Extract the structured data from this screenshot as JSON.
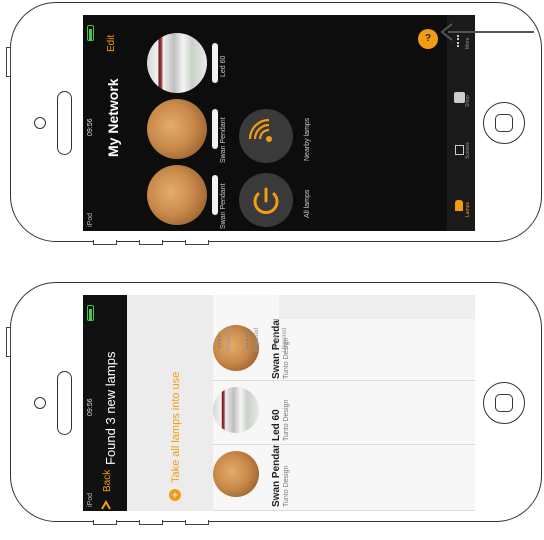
{
  "colors": {
    "accent": "#f39c12",
    "screen_dark": "#0d0d0d",
    "screen_light": "#eeeeef"
  },
  "top_screen": {
    "status": {
      "carrier": "iPod",
      "time": "09:56"
    },
    "title": "My Network",
    "edit_label": "Edit",
    "lamps": [
      {
        "name": "Swan Pendant",
        "thumb": "copper"
      },
      {
        "name": "Swan Pendant",
        "thumb": "copper"
      },
      {
        "name": "Led 60",
        "thumb": "led"
      }
    ],
    "actions": [
      {
        "label": "All lamps",
        "icon": "power-icon"
      },
      {
        "label": "Nearby lamps",
        "icon": "nearby-icon"
      }
    ],
    "help_badge": "?",
    "tabs": [
      "Lamps",
      "Scenes",
      "Shop",
      "More"
    ]
  },
  "bottom_screen": {
    "status": {
      "carrier": "iPod",
      "time": "09:56"
    },
    "back_label": "Back",
    "title": "Found 3 new lamps",
    "take_all_label": "Take all lamps into use",
    "lamps": [
      {
        "name": "Swan Pendant",
        "maker": "Tunto Design",
        "stars": "●●●●○",
        "status": "Unpaired"
      },
      {
        "name": "Led 60",
        "maker": "Tunto Design",
        "stars": "●●●●●",
        "status": "Unpaired"
      },
      {
        "name": "Swan Pendant",
        "maker": "Tunto Design",
        "stars": "●●●●○",
        "status": "Unpaired"
      }
    ]
  }
}
